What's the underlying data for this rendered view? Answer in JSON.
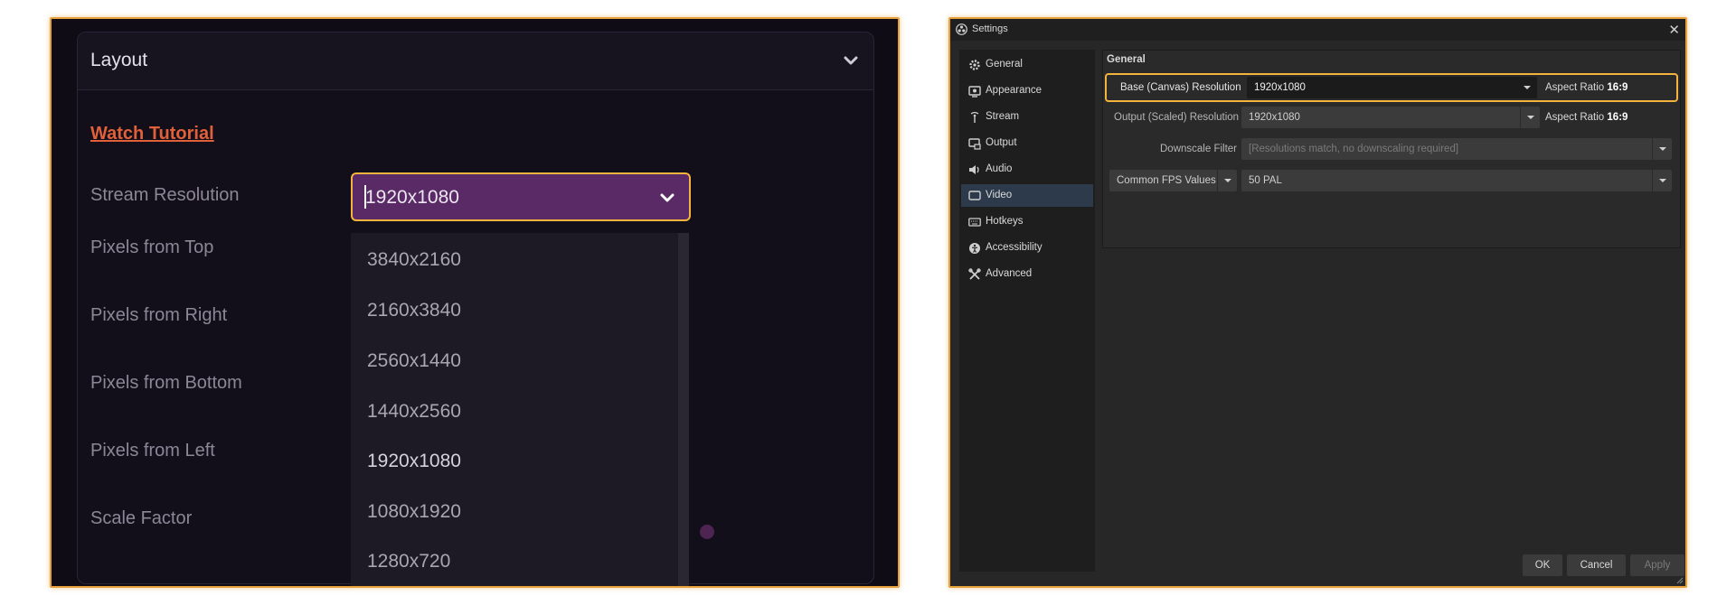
{
  "left_panel": {
    "section_title": "Layout",
    "watch_tutorial": "Watch Tutorial",
    "labels": {
      "stream_resolution": "Stream Resolution",
      "pixels_top": "Pixels from Top",
      "pixels_right": "Pixels from Right",
      "pixels_bottom": "Pixels from Bottom",
      "pixels_left": "Pixels from Left",
      "scale_factor": "Scale Factor"
    },
    "resolution_select": {
      "value": "1920x1080",
      "options": [
        "3840x2160",
        "2160x3840",
        "2560x1440",
        "1440x2560",
        "1920x1080",
        "1080x1920",
        "1280x720"
      ]
    },
    "colors": {
      "accent": "#f4b33e",
      "select_bg": "#5a2a66",
      "link": "#e0603a"
    }
  },
  "obs_settings": {
    "window_title": "Settings",
    "sidebar": [
      {
        "label": "General",
        "icon": "gear-icon"
      },
      {
        "label": "Appearance",
        "icon": "appearance-icon"
      },
      {
        "label": "Stream",
        "icon": "antenna-icon"
      },
      {
        "label": "Output",
        "icon": "output-icon"
      },
      {
        "label": "Audio",
        "icon": "speaker-icon"
      },
      {
        "label": "Video",
        "icon": "monitor-icon"
      },
      {
        "label": "Hotkeys",
        "icon": "keyboard-icon"
      },
      {
        "label": "Accessibility",
        "icon": "accessibility-icon"
      },
      {
        "label": "Advanced",
        "icon": "wrench-icon"
      }
    ],
    "active_item": "Video",
    "group_title": "General",
    "base_label": "Base (Canvas) Resolution",
    "base_value": "1920x1080",
    "base_aspect_prefix": "Aspect Ratio",
    "base_aspect": "16:9",
    "output_label": "Output (Scaled) Resolution",
    "output_value": "1920x1080",
    "output_aspect_prefix": "Aspect Ratio",
    "output_aspect": "16:9",
    "downscale_label": "Downscale Filter",
    "downscale_value": "[Resolutions match, no downscaling required]",
    "fps_type": "Common FPS Values",
    "fps_value": "50 PAL",
    "buttons": {
      "ok": "OK",
      "cancel": "Cancel",
      "apply": "Apply"
    }
  }
}
